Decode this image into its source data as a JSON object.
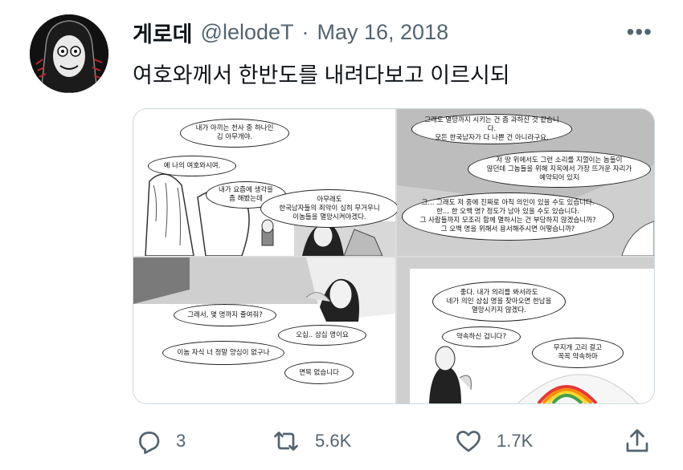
{
  "tweet": {
    "display_name": "게로데",
    "handle": "@lelodeT",
    "separator": "·",
    "date": "May 16, 2018",
    "more_label": "•••",
    "text": "여호와께서 한반도를 내려다보고 이르시되"
  },
  "comic": {
    "p1_b1": "내가 아끼는 천사 중 하나인\n김 아무개야.",
    "p1_b2": "예 나의 여호와시여.",
    "p1_b3": "내가 요즘에 생각을\n좀 해봤는데",
    "p1_b4": "아무래도\n한국남자들의 죄악이 심히 무거우니\n이놈들을 멸망시켜야겠다.",
    "p2_b1": "그래도 멸망까지 시키는 건 좀 과하신 것 같습니다.\n모든 한국남자가 다 나쁜 건 아니라구요.",
    "p2_b2": "저 땅 위에서도 그런 소리를 지껄이는 놈들이\n많던데 그놈들을 위해 지옥에서 가장 뜨거운 자리가\n예약되어 있지",
    "p2_b3": "그... 그래도 저 중에 진짜로 아직 의인이 있을 수도 있습니다.\n한... 한 오백 명? 정도가 남아 있을 수도 있습니다.\n그 사람들까지 모조리 함께 멸하시는 건 부당하지 않겠습니까?\n그 오백 명을 위해서 용서해주시면 어떻습니까?",
    "p3_b1": "그래서, 몇 명까지 줄여줘?",
    "p3_b2": "오십.. 삼십 명이요",
    "p3_b3": "이놈 자식 너 정말 양심이 없구나",
    "p3_b4": "면목 없습니다",
    "p4_b1": "좋다. 내가 의리를 봐서라도\n네가 의인 삼십 명을 찾아오면 한남을\n멸망시키지 않겠다.",
    "p4_b2": "약속하신 겁니다?",
    "p4_b3": "무지개 고리 걸고\n꼭꼭 약속하마"
  },
  "actions": {
    "reply_count": "3",
    "retweet_count": "5.6K",
    "like_count": "1.7K"
  },
  "icons": {
    "reply": "reply-icon",
    "retweet": "retweet-icon",
    "like": "heart-icon",
    "share": "share-icon",
    "more": "more-icon"
  }
}
